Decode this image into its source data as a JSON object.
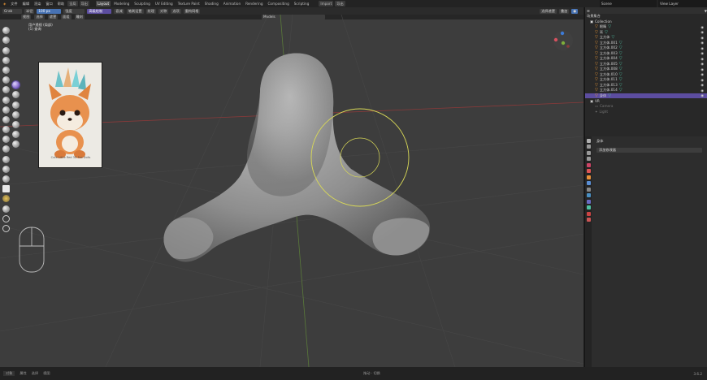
{
  "menu": {
    "items": [
      "文件",
      "编辑",
      "渲染",
      "窗口",
      "帮助"
    ],
    "workspace_tabs": [
      "Layout",
      "Modeling",
      "Sculpting",
      "UV Editing",
      "Texture Paint",
      "Shading",
      "Animation",
      "Rendering",
      "Compositing",
      "Scripting"
    ],
    "active_tab": "Layout",
    "scene_label": "Scene",
    "view_layer_label": "View Layer",
    "mode_buttons": [
      "全局",
      "导出",
      "Import",
      "导出"
    ]
  },
  "header": {
    "mode": "Grab",
    "items": [
      "半径",
      "100 px",
      "强度",
      "衰减",
      "笔刷设置",
      "纹理",
      "对称",
      "选项",
      "重构网格"
    ],
    "active_button": "高级绘制",
    "view_menu": [
      "视图",
      "选择",
      "遮罩",
      "面组",
      "雕刻"
    ],
    "center_label": "Models",
    "shading_label": "选择遮罩",
    "overlay_label": "叠加"
  },
  "viewport": {
    "info_line1": "用户透视 (局部)",
    "info_line2": "(1) 查询",
    "ref_caption": "Cute Little Red 3D Fox Dolls"
  },
  "outliner": {
    "title": "场景集合",
    "collection": "Collection",
    "items": [
      {
        "name": "眼睛",
        "icon": "triangle",
        "selected": false
      },
      {
        "name": "耳",
        "icon": "triangle",
        "selected": false
      },
      {
        "name": "立方体",
        "icon": "triangle",
        "selected": false
      },
      {
        "name": "立方体.001",
        "icon": "triangle",
        "selected": false
      },
      {
        "name": "立方体.002",
        "icon": "triangle",
        "selected": false
      },
      {
        "name": "立方体.003",
        "icon": "triangle",
        "selected": false
      },
      {
        "name": "立方体.004",
        "icon": "triangle",
        "selected": false
      },
      {
        "name": "立方体.005",
        "icon": "triangle",
        "selected": false
      },
      {
        "name": "立方体.008",
        "icon": "triangle",
        "selected": false
      },
      {
        "name": "立方体.010",
        "icon": "triangle",
        "selected": false
      },
      {
        "name": "立方体.011",
        "icon": "triangle",
        "selected": false
      },
      {
        "name": "立方体.013",
        "icon": "triangle",
        "selected": false
      },
      {
        "name": "立方体.014",
        "icon": "triangle",
        "selected": false
      },
      {
        "name": "身体",
        "icon": "triangle",
        "selected": true
      }
    ],
    "col2": "VR",
    "camera": "Camera",
    "light": "Light"
  },
  "properties": {
    "tab_label": "身体",
    "modifier_label": "添加修改器"
  },
  "statusbar": {
    "left": [
      "对象",
      "属性",
      "选择",
      "视图"
    ],
    "center": "拖动  ·  切换",
    "right": "3.6.2"
  },
  "colors": {
    "accent": "#4772b3",
    "active": "#5c4da0",
    "viewport": "#3d3d3d",
    "brush_circle": "#d9d957",
    "axis_red": "#8a3a3a",
    "axis_green": "#5a7a3a"
  }
}
